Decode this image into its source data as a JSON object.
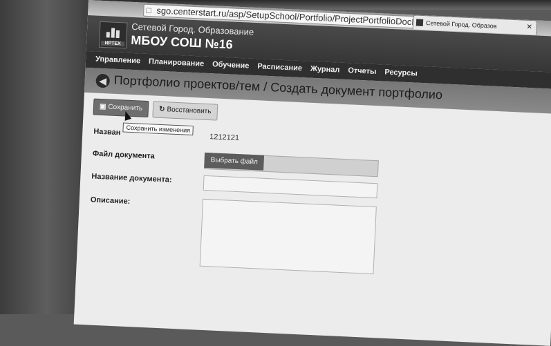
{
  "browser": {
    "url": "sgo.centerstart.ru/asp/SetupSchool/Portfolio/ProjectPortfolioDocEdit.asp",
    "tab_title": "Сетевой Город. Образов"
  },
  "header": {
    "logo_text": "ИРТЕХ",
    "brand_title": "Сетевой Город. Образование",
    "school_name": "МБОУ СОШ №16"
  },
  "nav": {
    "items": [
      {
        "label": "Управление"
      },
      {
        "label": "Планирование"
      },
      {
        "label": "Обучение"
      },
      {
        "label": "Расписание"
      },
      {
        "label": "Журнал"
      },
      {
        "label": "Отчеты"
      },
      {
        "label": "Ресурсы"
      }
    ]
  },
  "page": {
    "title": "Портфолио проектов/тем / Создать документ портфолио"
  },
  "toolbar": {
    "save_label": "Сохранить",
    "restore_label": "Восстановить",
    "save_tooltip": "Сохранить изменения"
  },
  "form": {
    "name_label": "Назван",
    "name_value": "1212121",
    "file_label": "Файл документа",
    "choose_file_label": "Выбрать файл",
    "doc_title_label": "Название документа:",
    "description_label": "Описание:"
  }
}
